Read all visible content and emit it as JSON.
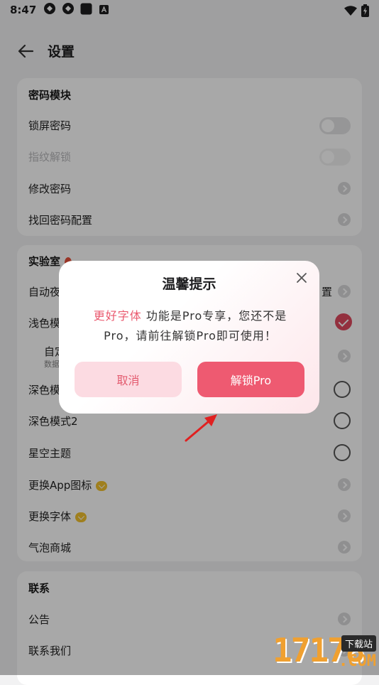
{
  "status_bar": {
    "time": "8:47",
    "icons": [
      "app-icon",
      "app-icon",
      "square-icon",
      "a-badge-icon",
      "wifi-icon",
      "battery-charging-icon"
    ]
  },
  "header": {
    "title": "设置",
    "back_icon": "arrow-left-icon"
  },
  "sections": {
    "password": {
      "title": "密码模块",
      "items": [
        {
          "label": "锁屏密码",
          "control": "toggle-off"
        },
        {
          "label": "指纹解锁",
          "control": "toggle-disabled"
        },
        {
          "label": "修改密码",
          "control": "chevron"
        },
        {
          "label": "找回密码配置",
          "control": "chevron"
        }
      ]
    },
    "lab": {
      "title": "实验室",
      "items": [
        {
          "label": "自动夜",
          "suffix": "置",
          "control": "chevron"
        },
        {
          "label": "浅色模",
          "control": "radio-checked"
        },
        {
          "label": "自定",
          "sub": "数据",
          "control": "chevron"
        },
        {
          "label": "深色模",
          "control": "radio"
        },
        {
          "label": "深色模式2",
          "control": "radio"
        },
        {
          "label": "星空主题",
          "control": "radio"
        },
        {
          "label": "更换App图标",
          "control": "chevron"
        },
        {
          "label": "更换字体",
          "control": "chevron"
        },
        {
          "label": "气泡商城",
          "control": "chevron"
        }
      ]
    },
    "contact": {
      "title": "联系",
      "items": [
        {
          "label": "公告",
          "control": "chevron"
        },
        {
          "label": "联系我们",
          "control": "chevron"
        }
      ]
    }
  },
  "dialog": {
    "title": "温馨提示",
    "highlight": "更好字体",
    "message_line1": " 功能是Pro专享，您还不是",
    "message_line2": "Pro，请前往解锁Pro即可使用！",
    "cancel_label": "取消",
    "unlock_label": "解锁Pro"
  },
  "watermark": {
    "number": "17178",
    "tag": "下载站",
    "domain": ".COM"
  },
  "colors": {
    "accent": "#ee5a71",
    "accent_light": "#fcdbe2",
    "highlight_text": "#ea5a6f",
    "badge_gold": "#f2c12e"
  }
}
